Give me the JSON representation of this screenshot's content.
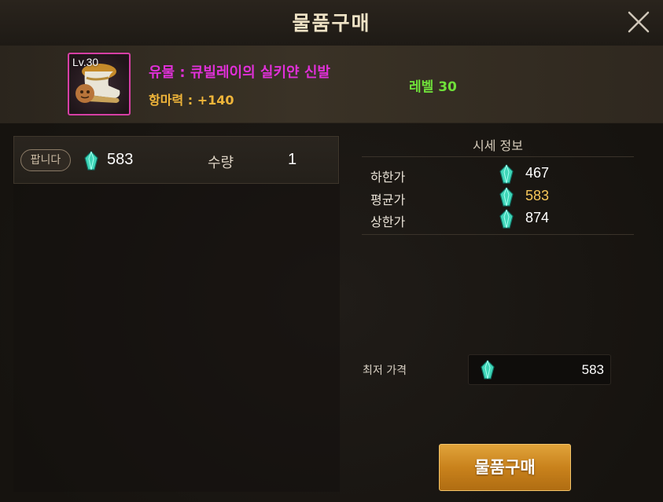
{
  "window": {
    "title": "물품구매"
  },
  "item": {
    "level_badge": "Lv.30",
    "name": "유물 : 큐빌레이의 실키얀 신발",
    "stat": "항마력 : +140",
    "level_requirement": "레벨 30",
    "rarity_color": "#d63fa5",
    "icon": "boots-icon"
  },
  "listing": {
    "badge": "팝니다",
    "price": "583",
    "quantity_label": "수량",
    "quantity": "1",
    "currency_icon": "gem-icon"
  },
  "market_info": {
    "title": "시세 정보",
    "rows": [
      {
        "label": "하한가",
        "value": "467",
        "color": "#ffffff"
      },
      {
        "label": "평균가",
        "value": "583",
        "color": "#f5c65a"
      },
      {
        "label": "상한가",
        "value": "874",
        "color": "#ffffff"
      }
    ]
  },
  "lowest": {
    "label": "최저 가격",
    "value": "583"
  },
  "buttons": {
    "buy": "물품구매"
  },
  "colors": {
    "accent": "#d89526",
    "gem": "#3fd6b8"
  }
}
